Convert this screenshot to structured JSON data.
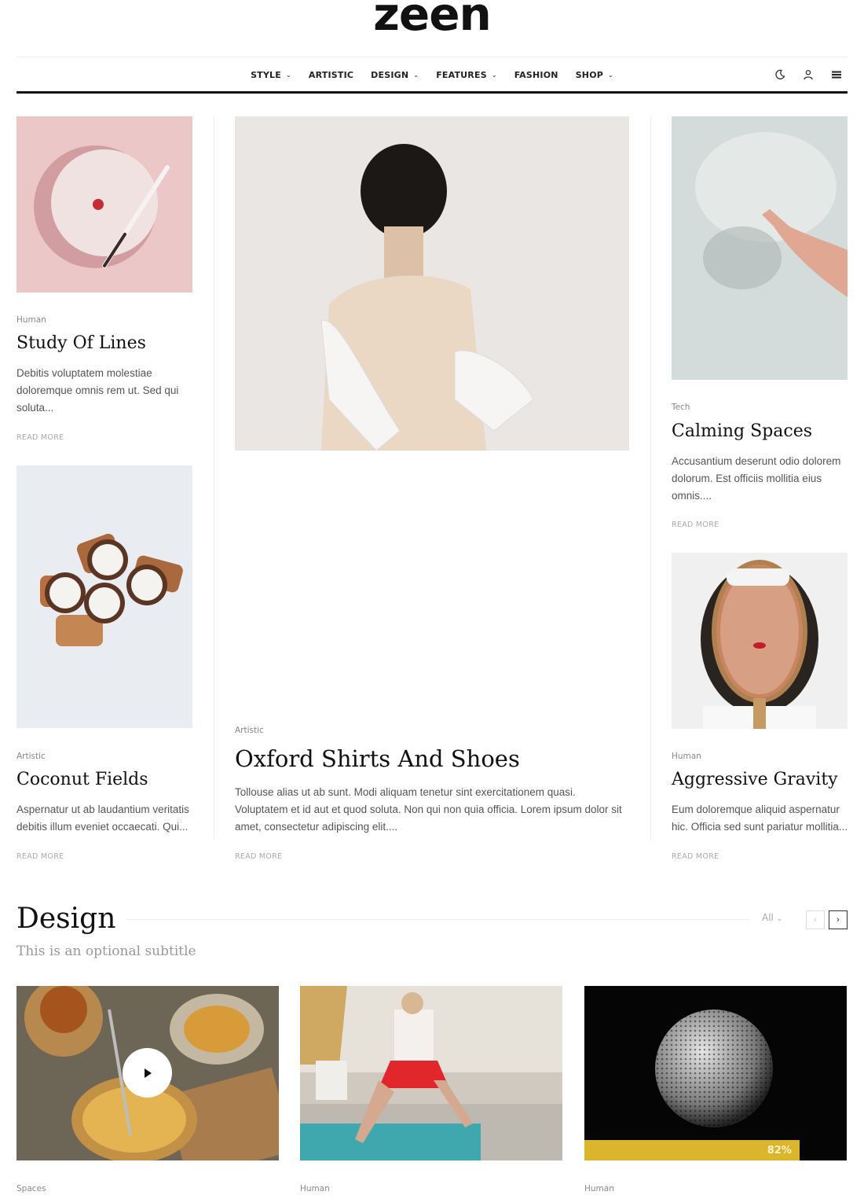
{
  "site": {
    "logo": "zeen"
  },
  "nav": {
    "items": [
      {
        "label": "STYLE",
        "has_dropdown": true
      },
      {
        "label": "ARTISTIC",
        "has_dropdown": false
      },
      {
        "label": "DESIGN",
        "has_dropdown": true
      },
      {
        "label": "FEATURES",
        "has_dropdown": true
      },
      {
        "label": "FASHION",
        "has_dropdown": false
      },
      {
        "label": "SHOP",
        "has_dropdown": true
      }
    ],
    "icons": [
      "moon-icon",
      "user-icon",
      "menu-icon"
    ],
    "chevron": "⌄"
  },
  "posts": {
    "study": {
      "category": "Human",
      "title": "Study Of Lines",
      "excerpt": "Debitis voluptatem molestiae doloremque omnis rem ut. Sed qui soluta...",
      "more": "READ MORE"
    },
    "coconut": {
      "category": "Artistic",
      "title": "Coconut Fields",
      "excerpt": "Aspernatur ut ab laudantium veritatis debitis illum eveniet occaecati. Qui...",
      "more": "READ MORE"
    },
    "oxford": {
      "category": "Artistic",
      "title": "Oxford Shirts And Shoes",
      "excerpt": "Tollouse alias ut ab sunt. Modi aliquam tenetur sint exercitationem quasi. Voluptatem et id aut et quod soluta. Non qui non quia officia. Lorem ipsum dolor sit amet, consectetur adipiscing elit....",
      "more": "READ MORE"
    },
    "calming": {
      "category": "Tech",
      "title": "Calming Spaces",
      "excerpt": "Accusantium deserunt odio dolorem dolorum. Est officiis mollitia eius omnis....",
      "more": "READ MORE"
    },
    "gravity": {
      "category": "Human",
      "title": "Aggressive Gravity",
      "excerpt": "Eum doloremque aliquid aspernatur hic. Officia sed sunt pariatur mollitia...",
      "more": "READ MORE"
    }
  },
  "design_section": {
    "title": "Design",
    "subtitle": "This is an optional subtitle",
    "filter": "All",
    "filter_chevron": "⌄",
    "prev": "‹",
    "next": "›",
    "cards": [
      {
        "category": "Spaces",
        "has_play": true
      },
      {
        "category": "Human"
      },
      {
        "category": "Human",
        "progress_percent": 82,
        "progress_label": "82%"
      }
    ]
  },
  "colors": {
    "accent": "#dbb62d",
    "text": "#111111",
    "muted": "#888888"
  }
}
